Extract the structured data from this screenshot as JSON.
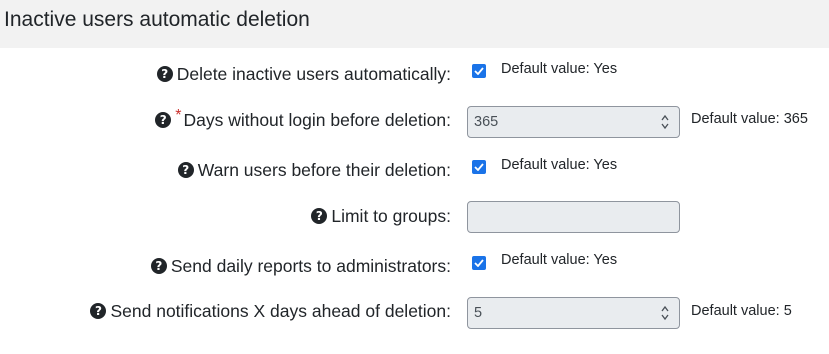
{
  "section": {
    "title": "Inactive users automatic deletion"
  },
  "settings": [
    {
      "label": "Delete inactive users automatically:",
      "control": "checkbox",
      "checked": true,
      "default": "Default value: Yes"
    },
    {
      "label": "Days without login before deletion:",
      "required": true,
      "required_mark": "*",
      "control": "number",
      "value": "365",
      "default": "Default value: 365"
    },
    {
      "label": "Warn users before their deletion:",
      "control": "checkbox",
      "checked": true,
      "default": "Default value: Yes"
    },
    {
      "label": "Limit to groups:",
      "control": "text",
      "value": ""
    },
    {
      "label": "Send daily reports to administrators:",
      "control": "checkbox",
      "checked": true,
      "default": "Default value: Yes"
    },
    {
      "label": "Send notifications X days ahead of deletion:",
      "control": "number",
      "value": "5",
      "default": "Default value: 5"
    }
  ],
  "icons": {
    "help": "question-circle-icon",
    "check": "checkmark-icon",
    "spinner": "spinner-arrows-icon"
  },
  "colors": {
    "checkbox": "#1a73e8",
    "required": "#c9302c",
    "header_bg": "#f2f2f2",
    "input_bg": "#e9ecef"
  }
}
